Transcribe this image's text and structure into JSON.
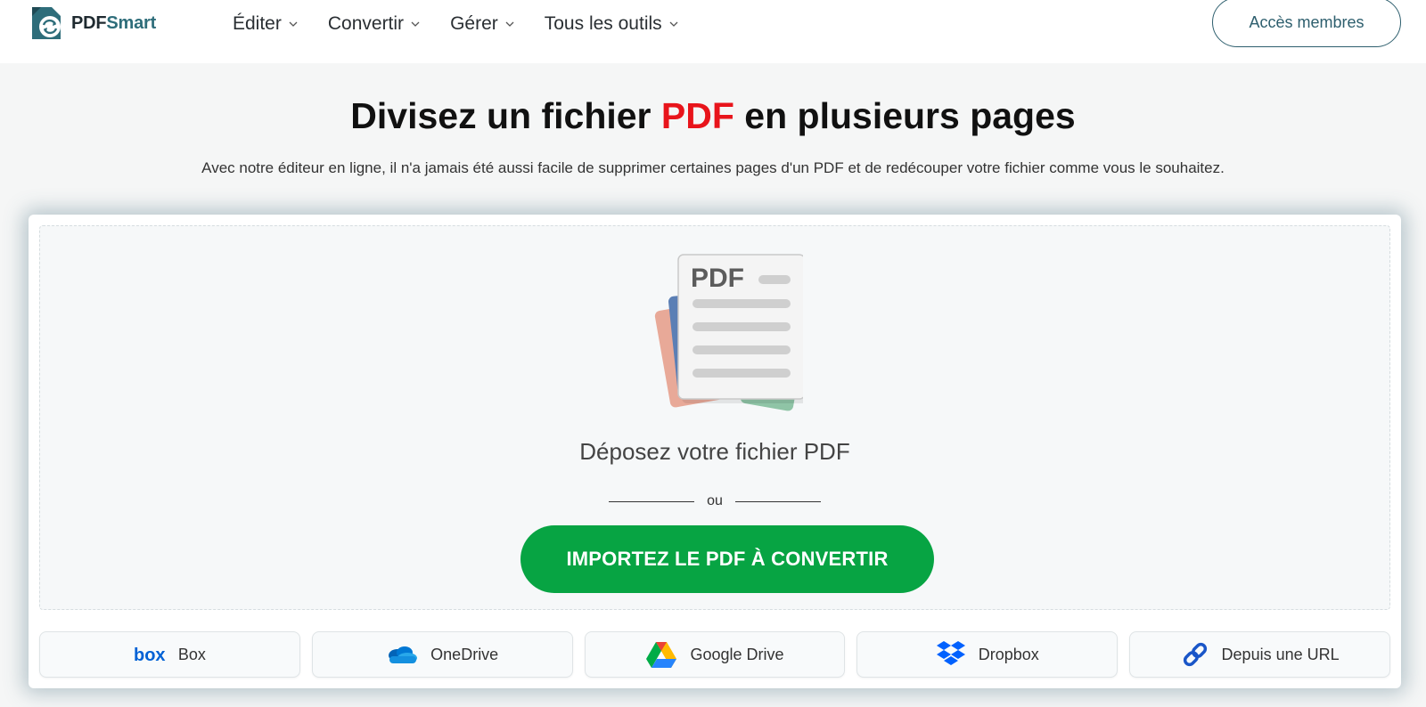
{
  "brand": {
    "name_part1": "PDF",
    "name_part2": "Smart",
    "accent": "#2e6d7a"
  },
  "nav": [
    {
      "label": "Éditer"
    },
    {
      "label": "Convertir"
    },
    {
      "label": "Gérer"
    },
    {
      "label": "Tous les outils"
    }
  ],
  "member_button": "Accès membres",
  "hero": {
    "title_before": "Divisez un fichier ",
    "title_highlight": "PDF",
    "title_after": " en plusieurs pages",
    "subtitle": "Avec notre éditeur en ligne, il n'a jamais été aussi facile de supprimer certaines pages d'un PDF et de redécouper votre fichier comme vous le souhaitez."
  },
  "dropzone": {
    "doc_label": "PDF",
    "drop_text": "Déposez votre fichier PDF",
    "or_text": "ou",
    "import_button": "IMPORTEZ LE PDF À CONVERTIR"
  },
  "sources": [
    {
      "label": "Box",
      "icon": "box-icon"
    },
    {
      "label": "OneDrive",
      "icon": "onedrive-icon"
    },
    {
      "label": "Google Drive",
      "icon": "google-drive-icon"
    },
    {
      "label": "Dropbox",
      "icon": "dropbox-icon"
    },
    {
      "label": "Depuis une URL",
      "icon": "link-icon"
    }
  ],
  "colors": {
    "primary_green": "#07a443",
    "highlight_red": "#e8141b",
    "outline_teal": "#2e5f6e"
  }
}
